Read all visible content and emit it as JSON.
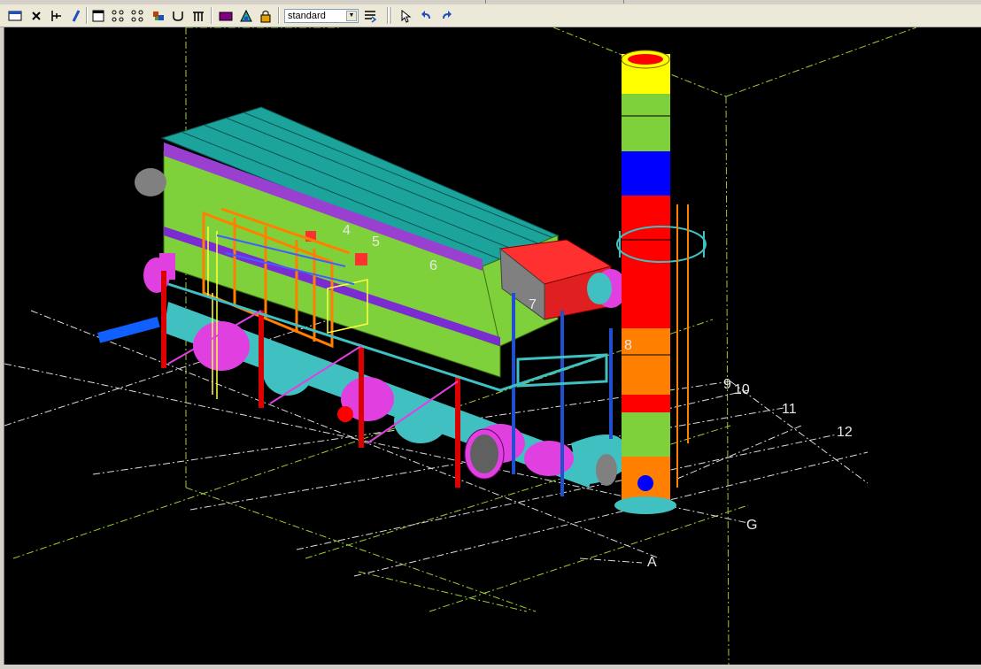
{
  "toolbar": {
    "buttons": [
      {
        "name": "window-icon"
      },
      {
        "name": "close-cross-icon"
      },
      {
        "name": "column-icon"
      },
      {
        "name": "pencil-icon"
      },
      {
        "name": "frame-icon"
      },
      {
        "name": "grid-dots-icon"
      },
      {
        "name": "grid-dots-alt-icon"
      },
      {
        "name": "component-icon"
      },
      {
        "name": "curve-icon"
      },
      {
        "name": "portal-icon"
      },
      {
        "name": "shaded-box-icon"
      },
      {
        "name": "render-icon"
      },
      {
        "name": "lock-icon"
      }
    ],
    "view_combo": {
      "value": "standard"
    },
    "after_combo": [
      {
        "name": "filter-icon"
      },
      {
        "name": "select-arrow-icon"
      },
      {
        "name": "undo-icon"
      },
      {
        "name": "redo-icon"
      }
    ]
  },
  "viewport": {
    "grid_labels": {
      "n4": "4",
      "n5": "5",
      "n6": "6",
      "n7": "7",
      "n8": "8",
      "n9": "9",
      "n10": "10",
      "n11": "11",
      "n12": "12",
      "g": "G",
      "a": "A"
    },
    "colors": {
      "background": "#000000",
      "grid": "#9acd32",
      "grid_white": "#dcdcdc",
      "roof": "#1ba39c",
      "wall": "#7fd13b",
      "stack_red": "#ff0000",
      "stack_yellow": "#ffff00",
      "stack_blue": "#0000ff",
      "stack_orange": "#ff8000",
      "duct_cyan": "#40c0c0",
      "duct_magenta": "#e040e0",
      "steel_red": "#dd0000",
      "rail_orange": "#ff8000",
      "rail_yellow": "#ffff40"
    }
  }
}
